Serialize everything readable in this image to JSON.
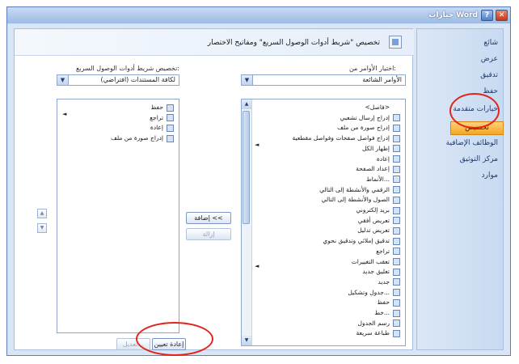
{
  "window": {
    "title": "خيارات Word",
    "help_glyph": "?",
    "close_glyph": "✕"
  },
  "sidebar": {
    "items": [
      {
        "label": "شائع"
      },
      {
        "label": "عرض"
      },
      {
        "label": "تدقيق"
      },
      {
        "label": "حفظ"
      },
      {
        "label": "خيارات متقدمة"
      },
      {
        "label": "تخصيص",
        "active": true
      },
      {
        "label": "الوظائف الإضافية"
      },
      {
        "label": "مركز التوثيق"
      },
      {
        "label": "موارد"
      }
    ]
  },
  "header": {
    "text": "تخصيص \"شريط أدوات الوصول السريع\" ومفاتيح الاختصار"
  },
  "left_panel": {
    "label": "اختيار الأوامر من:",
    "combo_value": "الأوامر الشائعة",
    "items": [
      "<فاصل>",
      "إدراج إرسال تشعبي",
      "إدراج صورة من ملف",
      "إدراج فواصل صفحات وفواصل مقطعية",
      "إظهار الكل",
      "إعادة",
      "إعداد الصفحة",
      "الأنماط...",
      "الرقمي والأنشطة إلى التالي",
      "الصول والأنشطة إلى التالي",
      "بريد إلكتروني",
      "تعريض أفقي",
      "تعريض تدليل",
      "تدقيق إملائي وتدقيق نحوي",
      "تراجع",
      "تعقب التغييرات",
      "تعليق جديد",
      "جديد",
      "جدول وتشكيل...",
      "حفظ",
      "خط...",
      "رسم الجدول",
      "طباعة سريعة"
    ]
  },
  "right_panel": {
    "label": "تخصيص شريط أدوات الوصول السريع:",
    "combo_value": "لكافة المستندات (افتراضي)",
    "items": [
      "حفظ",
      "تراجع",
      "إعادة",
      "إدراج صورة من ملف"
    ]
  },
  "buttons": {
    "add": "إضافة <<",
    "remove": "إزالة",
    "reset": "إعادة تعيين",
    "modify": "تعديل..."
  },
  "arrows": {
    "expand": "◄",
    "up": "▲",
    "down": "▼",
    "combo": "▼"
  }
}
